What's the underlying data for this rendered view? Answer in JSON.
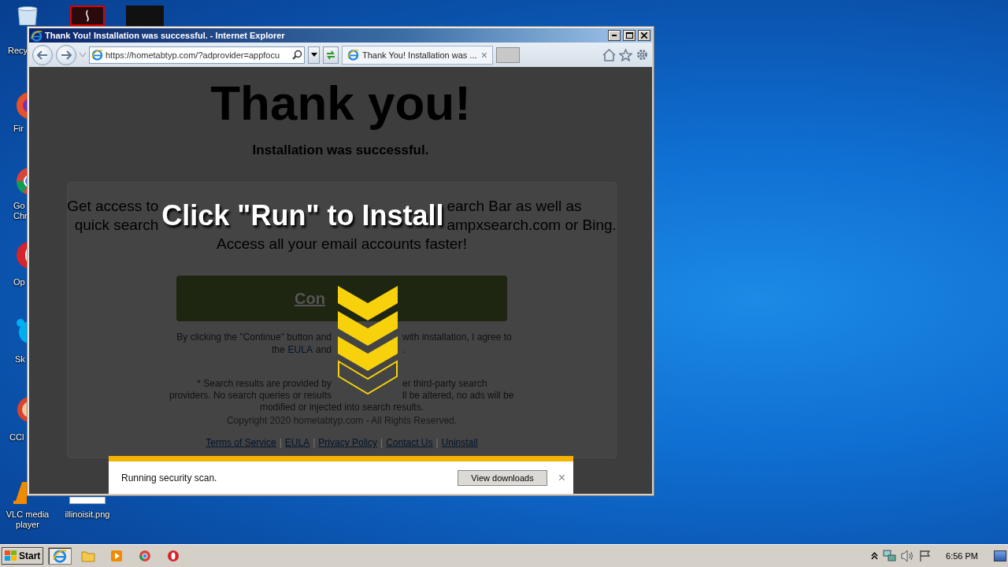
{
  "desktop": {
    "icons": [
      {
        "kind": "recycle",
        "label": "Recy"
      },
      {
        "kind": "firefox",
        "label": "Fir"
      },
      {
        "kind": "chrome",
        "label": "Go Chr"
      },
      {
        "kind": "opera",
        "label": "Op"
      },
      {
        "kind": "skype",
        "label": "Sk"
      },
      {
        "kind": "ccleaner",
        "label": "CCl"
      },
      {
        "kind": "vlc",
        "label": "VLC media player"
      },
      {
        "kind": "image",
        "label": "illinoisit.png"
      },
      {
        "kind": "pdf"
      },
      {
        "kind": "dark"
      }
    ]
  },
  "window": {
    "title": "Thank You! Installation was successful. - Internet Explorer",
    "address": "https://hometabtyp.com/?adprovider=appfocu",
    "tab": {
      "label": "Thank You! Installation was ...",
      "close": "×",
      "selected": true
    }
  },
  "page": {
    "heading": "Thank you!",
    "subheading": "Installation was successful.",
    "intro_lines": [
      {
        "parts": [
          {
            "kind": "text",
            "text": "Get access to",
            "covered_after": true
          },
          {
            "kind": "text",
            "text": "earch Bar as well as"
          }
        ]
      },
      {
        "parts": [
          {
            "kind": "text",
            "text": "quick search",
            "covered_after": true
          },
          {
            "kind": "text",
            "text": "ampxsearch.com or Bing."
          }
        ]
      },
      {
        "parts": [
          {
            "kind": "text",
            "text": "Access all your email accounts faster!"
          }
        ]
      }
    ],
    "continue_button": "Con",
    "terms_lines": [
      {
        "parts": [
          {
            "kind": "text",
            "text": "By clicking the \"Continue\" button and",
            "covered_after": true
          },
          {
            "kind": "text",
            "text": "with installation, I agree to"
          }
        ]
      },
      {
        "parts": [
          {
            "kind": "text",
            "text": "the"
          },
          {
            "kind": "link",
            "text": "EULA"
          },
          {
            "kind": "text",
            "text": "and",
            "covered_after": true
          },
          {
            "kind": "text",
            "text": "."
          }
        ]
      }
    ],
    "disclaimer_lines": [
      {
        "parts": [
          {
            "kind": "text",
            "text": "* Search results are provided by",
            "covered_after": true
          },
          {
            "kind": "text",
            "text": "er third-party search"
          }
        ]
      },
      {
        "parts": [
          {
            "kind": "text",
            "text": "providers. No search queries or results",
            "covered_after": true
          },
          {
            "kind": "text",
            "text": "ll be altered, no ads will be"
          }
        ]
      },
      {
        "parts": [
          {
            "kind": "text",
            "text": "modified or injected into search results."
          }
        ]
      }
    ],
    "copyright": "Copyright 2020 hometabtyp.com - All Rights Reserved.",
    "footer_links": [
      "Terms of Service",
      "EULA",
      "Privacy Policy",
      "Contact Us",
      "Uninstall"
    ],
    "footer_separator": "|"
  },
  "overlay": {
    "heading": "Click \"Run\" to Install"
  },
  "download_bar": {
    "message": "Running security scan.",
    "button": "View downloads",
    "close": "×"
  },
  "taskbar": {
    "start": "Start",
    "items": [
      {
        "kind": "ie",
        "selected": true
      },
      {
        "kind": "folder",
        "selected": false
      },
      {
        "kind": "media",
        "selected": false
      },
      {
        "kind": "chrome",
        "selected": false
      },
      {
        "kind": "opera",
        "selected": false
      }
    ],
    "clock": "6:56 PM"
  }
}
